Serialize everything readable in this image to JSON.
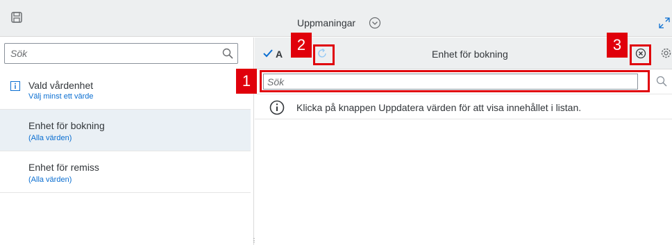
{
  "topbar": {
    "title": "Uppmaningar"
  },
  "left": {
    "search": {
      "placeholder": "Sök",
      "value": ""
    },
    "items": [
      {
        "title": "Vald vårdenhet",
        "subtitle": "Välj minst ett värde",
        "has_info_icon": true
      },
      {
        "title": "Enhet för bokning",
        "subtitle": "(Alla värden)",
        "selected": true
      },
      {
        "title": "Enhet för remiss",
        "subtitle": "(Alla värden)"
      }
    ]
  },
  "right": {
    "apply_label": "A",
    "title": "Enhet för bokning",
    "search": {
      "placeholder": "Sök",
      "value": ""
    },
    "info_message": "Klicka på knappen Uppdatera värden för att visa innehållet i listan."
  },
  "callouts": [
    {
      "number": "1"
    },
    {
      "number": "2"
    },
    {
      "number": "3"
    }
  ],
  "colors": {
    "callout": "#e0000b",
    "link": "#0a6ed1",
    "selected_bg": "#eaf0f5",
    "header_bg": "#edeff0"
  }
}
